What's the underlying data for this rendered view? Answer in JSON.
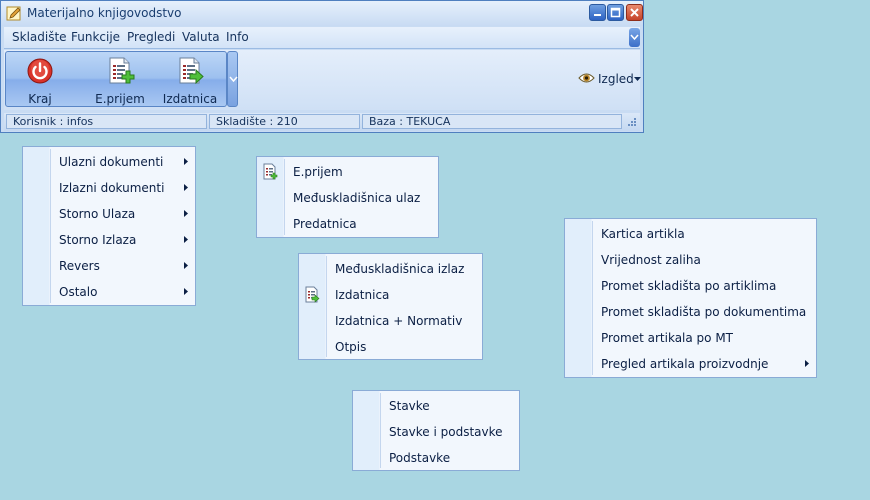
{
  "window": {
    "title": "Materijalno knjigovodstvo",
    "menu": [
      "Skladište",
      "Funkcije",
      "Pregledi",
      "Valuta",
      "Info"
    ],
    "toolbar": {
      "buttons": [
        {
          "label": "Kraj",
          "icon": "power-icon"
        },
        {
          "label": "E.prijem",
          "icon": "document-add-icon"
        },
        {
          "label": "Izdatnica",
          "icon": "document-export-icon"
        }
      ],
      "view_label": "Izgled"
    },
    "status": {
      "user": "Korisnik : infos",
      "warehouse": "Skladište : 210",
      "database": "Baza : TEKUCA"
    }
  },
  "menus": {
    "main": {
      "items": [
        {
          "label": "Ulazni dokumenti",
          "submenu": true
        },
        {
          "label": "Izlazni dokumenti",
          "submenu": true
        },
        {
          "label": "Storno Ulaza",
          "submenu": true
        },
        {
          "label": "Storno Izlaza",
          "submenu": true
        },
        {
          "label": "Revers",
          "submenu": true
        },
        {
          "label": "Ostalo",
          "submenu": true
        }
      ]
    },
    "ulazni": {
      "items": [
        {
          "label": "E.prijem",
          "icon": "document-add-icon"
        },
        {
          "label": "Međuskladišnica ulaz"
        },
        {
          "label": "Predatnica"
        }
      ]
    },
    "izlazni": {
      "items": [
        {
          "label": "Međuskladišnica izlaz"
        },
        {
          "label": "Izdatnica",
          "icon": "document-export-icon"
        },
        {
          "label": "Izdatnica + Normativ"
        },
        {
          "label": "Otpis"
        }
      ]
    },
    "stavke": {
      "items": [
        {
          "label": "Stavke"
        },
        {
          "label": "Stavke i podstavke"
        },
        {
          "label": "Podstavke"
        }
      ]
    },
    "pregledi": {
      "items": [
        {
          "label": "Kartica artikla"
        },
        {
          "label": "Vrijednost zaliha"
        },
        {
          "label": "Promet skladišta po artiklima"
        },
        {
          "label": "Promet skladišta po dokumentima"
        },
        {
          "label": "Promet artikala po MT"
        },
        {
          "label": "Pregled artikala proizvodnje",
          "submenu": true
        }
      ]
    }
  }
}
